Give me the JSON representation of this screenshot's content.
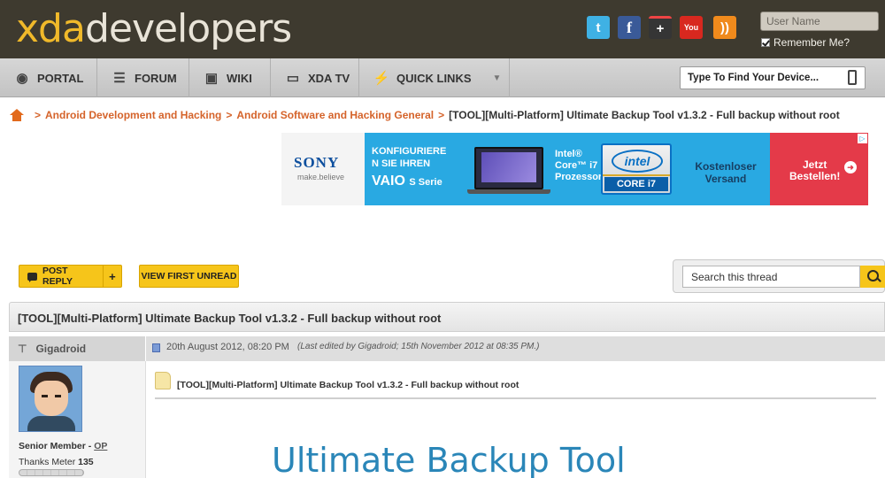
{
  "header": {
    "logo_xda": "xda",
    "logo_developers": "developers",
    "social": [
      {
        "icon": "twitter-icon",
        "glyph": "t"
      },
      {
        "icon": "facebook-icon",
        "glyph": "f"
      },
      {
        "icon": "google-plus-icon",
        "glyph": "+"
      },
      {
        "icon": "youtube-icon",
        "glyph": "You"
      },
      {
        "icon": "rss-icon",
        "glyph": "))"
      }
    ],
    "username_placeholder": "User Name",
    "remember_me": "Remember Me?"
  },
  "nav": {
    "items": [
      {
        "label": "PORTAL",
        "icon": "globe-icon"
      },
      {
        "label": "FORUM",
        "icon": "list-icon"
      },
      {
        "label": "WIKI",
        "icon": "box-icon"
      },
      {
        "label": "XDA TV",
        "icon": "tv-icon"
      },
      {
        "label": "QUICK LINKS",
        "icon": "lightning-icon"
      }
    ],
    "device_search_placeholder": "Type To Find Your Device..."
  },
  "breadcrumb": {
    "items": [
      "Android Development and Hacking",
      "Android Software and Hacking General"
    ],
    "current": "[TOOL][Multi-Platform] Ultimate Backup Tool v1.3.2 - Full backup without root"
  },
  "ad": {
    "brand": "SONY",
    "tagline": "make.believe",
    "line1": "KONFIGURIERE",
    "line2": "N SIE IHREN",
    "product": "VAIO",
    "product_series": "S Serie",
    "intel_text_1": "Intel®",
    "intel_text_2": "Core™ i7",
    "intel_text_3": "Prozessor",
    "intel_logo": "intel",
    "intel_badge": "CORE i7",
    "shipping_1": "Kostenloser",
    "shipping_2": "Versand",
    "cta_1": "Jetzt",
    "cta_2": "Bestellen!"
  },
  "toolbar": {
    "post_reply": "POST REPLY",
    "plus": "+",
    "view_first_unread": "VIEW FIRST UNREAD",
    "search_placeholder": "Search this thread"
  },
  "thread": {
    "title": "[TOOL][Multi-Platform] Ultimate Backup Tool v1.3.2 - Full backup without root"
  },
  "post": {
    "username": "Gigadroid",
    "date": "20th August 2012, 08:20 PM",
    "edited": "(Last edited by Gigadroid; 15th November 2012 at 08:35 PM.)",
    "rank": "Senior Member - ",
    "op": "OP",
    "thanks_label": "Thanks Meter ",
    "thanks_count": "135",
    "title": "[TOOL][Multi-Platform] Ultimate Backup Tool v1.3.2 - Full backup without root",
    "heading": "Ultimate Backup Tool"
  }
}
